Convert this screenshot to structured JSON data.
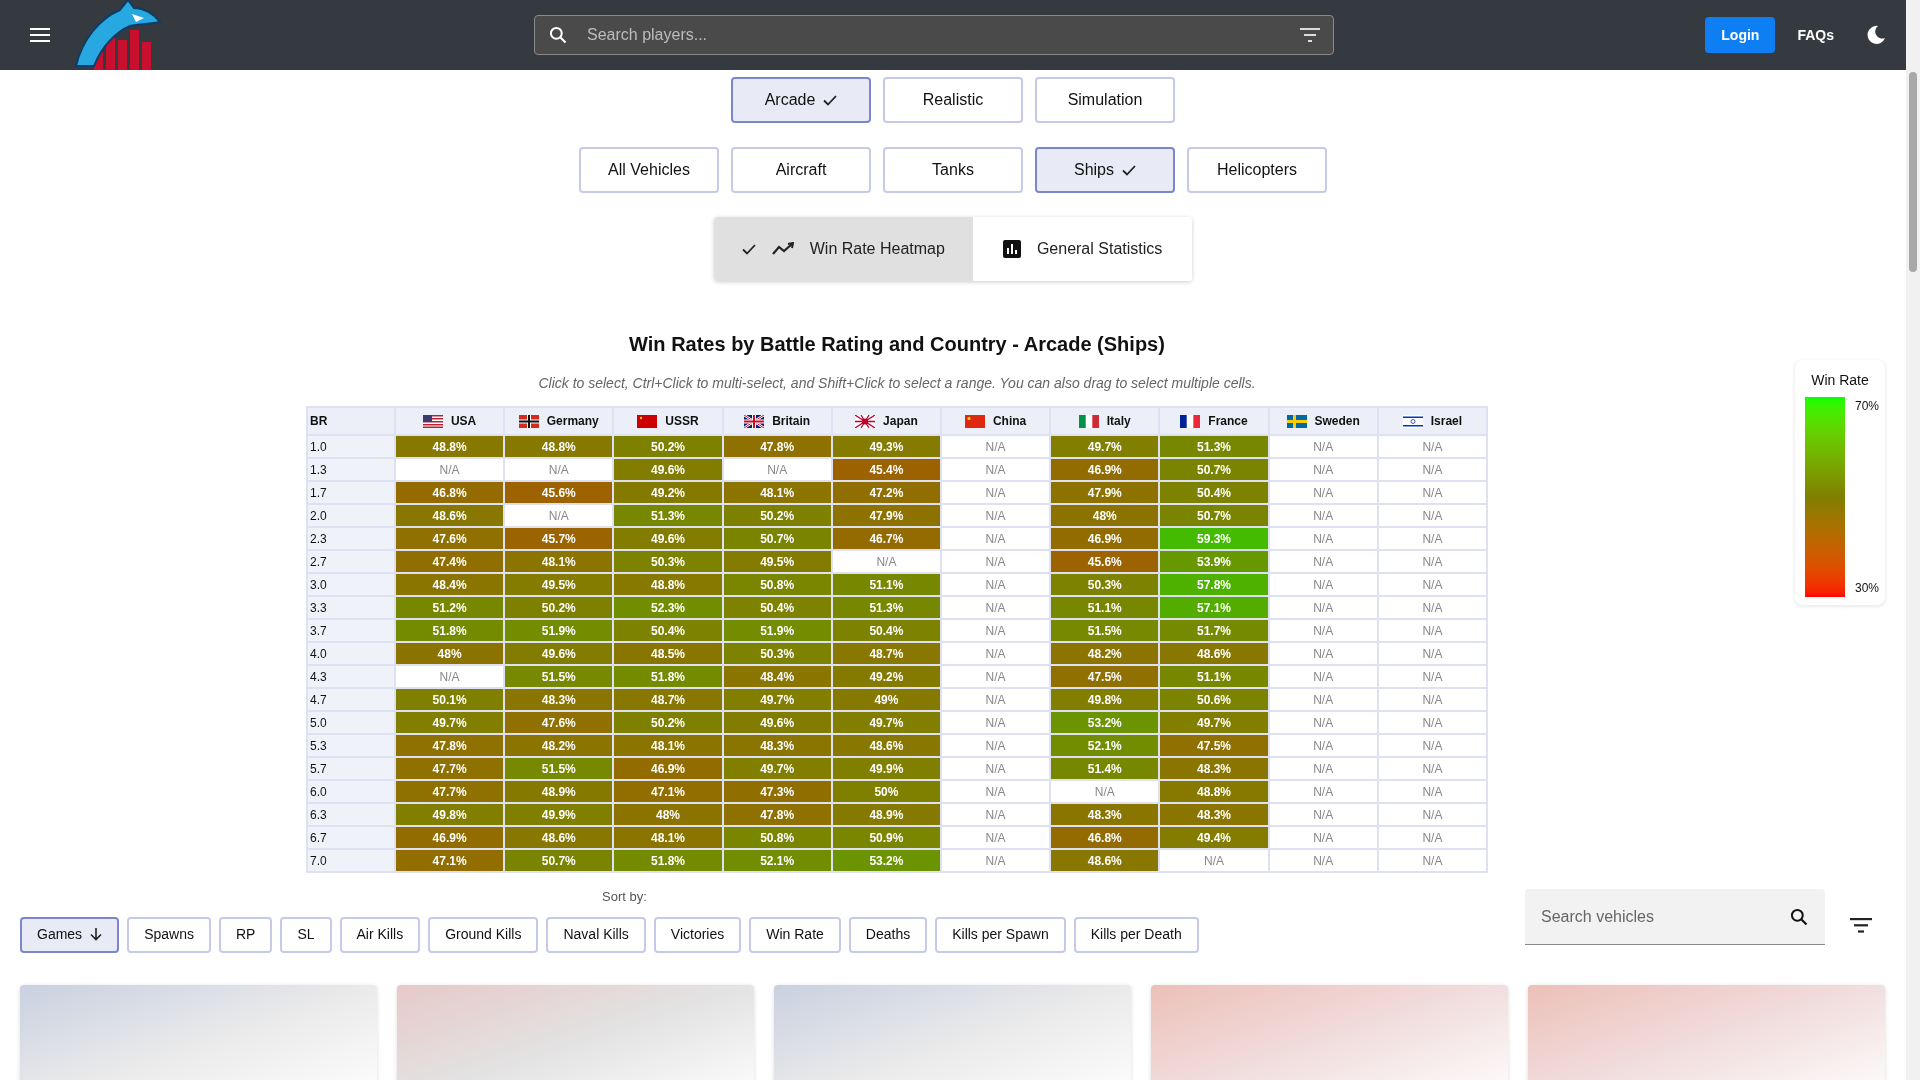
{
  "header": {
    "search": {
      "placeholder": "Search players..."
    },
    "login": "Login",
    "faqs": "FAQs"
  },
  "modes": [
    {
      "label": "Arcade",
      "selected": true
    },
    {
      "label": "Realistic",
      "selected": false
    },
    {
      "label": "Simulation",
      "selected": false
    }
  ],
  "vehicle_types": [
    {
      "label": "All Vehicles",
      "selected": false
    },
    {
      "label": "Aircraft",
      "selected": false
    },
    {
      "label": "Tanks",
      "selected": false
    },
    {
      "label": "Ships",
      "selected": true
    },
    {
      "label": "Helicopters",
      "selected": false
    }
  ],
  "views": [
    {
      "label": "Win Rate Heatmap",
      "selected": true,
      "kind": "heatmap"
    },
    {
      "label": "General Statistics",
      "selected": false,
      "kind": "stats"
    }
  ],
  "heatmap": {
    "title": "Win Rates by Battle Rating and Country - Arcade (Ships)",
    "hint": "Click to select, Ctrl+Click to multi-select, and Shift+Click to select a range. You can also drag to select multiple cells.",
    "corner": "BR",
    "countries": [
      {
        "name": "USA",
        "kind": "usa"
      },
      {
        "name": "Germany",
        "kind": "germany"
      },
      {
        "name": "USSR",
        "kind": "ussr"
      },
      {
        "name": "Britain",
        "kind": "britain"
      },
      {
        "name": "Japan",
        "kind": "japan"
      },
      {
        "name": "China",
        "kind": "china"
      },
      {
        "name": "Italy",
        "kind": "italy"
      },
      {
        "name": "France",
        "kind": "france"
      },
      {
        "name": "Sweden",
        "kind": "sweden"
      },
      {
        "name": "Israel",
        "kind": "israel"
      }
    ],
    "rows": [
      {
        "br": "1.0",
        "cells": [
          {
            "text": "48.8%",
            "color": "#877800"
          },
          {
            "text": "48.8%",
            "color": "#877800"
          },
          {
            "text": "50.2%",
            "color": "#7e8100"
          },
          {
            "text": "47.8%",
            "color": "#8e7100"
          },
          {
            "text": "49.3%",
            "color": "#847b00"
          },
          {
            "text": "N/A"
          },
          {
            "text": "49.7%",
            "color": "#817e00"
          },
          {
            "text": "51.3%",
            "color": "#778800"
          },
          {
            "text": "N/A"
          },
          {
            "text": "N/A"
          }
        ]
      },
      {
        "br": "1.3",
        "cells": [
          {
            "text": "N/A"
          },
          {
            "text": "N/A"
          },
          {
            "text": "49.6%",
            "color": "#827d00"
          },
          {
            "text": "N/A"
          },
          {
            "text": "45.4%",
            "color": "#9d6200"
          },
          {
            "text": "N/A"
          },
          {
            "text": "46.9%",
            "color": "#936c00"
          },
          {
            "text": "50.7%",
            "color": "#7b8400"
          },
          {
            "text": "N/A"
          },
          {
            "text": "N/A"
          }
        ]
      },
      {
        "br": "1.7",
        "cells": [
          {
            "text": "46.8%",
            "color": "#946b00"
          },
          {
            "text": "45.6%",
            "color": "#9c6300"
          },
          {
            "text": "49.2%",
            "color": "#857a00"
          },
          {
            "text": "48.1%",
            "color": "#8b7400"
          },
          {
            "text": "47.2%",
            "color": "#916e00"
          },
          {
            "text": "N/A"
          },
          {
            "text": "47.9%",
            "color": "#8d7200"
          },
          {
            "text": "50.4%",
            "color": "#7d8200"
          },
          {
            "text": "N/A"
          },
          {
            "text": "N/A"
          }
        ]
      },
      {
        "br": "2.0",
        "cells": [
          {
            "text": "48.6%",
            "color": "#887700"
          },
          {
            "text": "N/A"
          },
          {
            "text": "51.3%",
            "color": "#778800"
          },
          {
            "text": "50.2%",
            "color": "#7e8100"
          },
          {
            "text": "47.9%",
            "color": "#8d7200"
          },
          {
            "text": "N/A"
          },
          {
            "text": "48%",
            "color": "#8c7300"
          },
          {
            "text": "50.7%",
            "color": "#7b8400"
          },
          {
            "text": "N/A"
          },
          {
            "text": "N/A"
          }
        ]
      },
      {
        "br": "2.3",
        "cells": [
          {
            "text": "47.6%",
            "color": "#8f7000"
          },
          {
            "text": "45.7%",
            "color": "#9b6400"
          },
          {
            "text": "49.6%",
            "color": "#827d00"
          },
          {
            "text": "50.7%",
            "color": "#7b8400"
          },
          {
            "text": "46.7%",
            "color": "#946b00"
          },
          {
            "text": "N/A"
          },
          {
            "text": "46.9%",
            "color": "#936c00"
          },
          {
            "text": "59.3%",
            "color": "#44bb00"
          },
          {
            "text": "N/A"
          },
          {
            "text": "N/A"
          }
        ]
      },
      {
        "br": "2.7",
        "cells": [
          {
            "text": "47.4%",
            "color": "#906f00"
          },
          {
            "text": "48.1%",
            "color": "#8b7400"
          },
          {
            "text": "50.3%",
            "color": "#7d8200"
          },
          {
            "text": "49.5%",
            "color": "#837c00"
          },
          {
            "text": "N/A"
          },
          {
            "text": "N/A"
          },
          {
            "text": "45.6%",
            "color": "#9c6300"
          },
          {
            "text": "53.9%",
            "color": "#679800"
          },
          {
            "text": "N/A"
          },
          {
            "text": "N/A"
          }
        ]
      },
      {
        "br": "3.0",
        "cells": [
          {
            "text": "48.4%",
            "color": "#8a7500"
          },
          {
            "text": "49.5%",
            "color": "#837c00"
          },
          {
            "text": "48.8%",
            "color": "#877800"
          },
          {
            "text": "50.8%",
            "color": "#7a8500"
          },
          {
            "text": "51.1%",
            "color": "#788700"
          },
          {
            "text": "N/A"
          },
          {
            "text": "50.3%",
            "color": "#7d8200"
          },
          {
            "text": "57.8%",
            "color": "#4eb100"
          },
          {
            "text": "N/A"
          },
          {
            "text": "N/A"
          }
        ]
      },
      {
        "br": "3.3",
        "cells": [
          {
            "text": "51.2%",
            "color": "#788700"
          },
          {
            "text": "50.2%",
            "color": "#7e8100"
          },
          {
            "text": "52.3%",
            "color": "#718e00"
          },
          {
            "text": "50.4%",
            "color": "#7d8200"
          },
          {
            "text": "51.3%",
            "color": "#778800"
          },
          {
            "text": "N/A"
          },
          {
            "text": "51.1%",
            "color": "#788700"
          },
          {
            "text": "57.1%",
            "color": "#52ad00"
          },
          {
            "text": "N/A"
          },
          {
            "text": "N/A"
          }
        ]
      },
      {
        "br": "3.7",
        "cells": [
          {
            "text": "51.8%",
            "color": "#748b00"
          },
          {
            "text": "51.9%",
            "color": "#738c00"
          },
          {
            "text": "50.4%",
            "color": "#7d8200"
          },
          {
            "text": "51.9%",
            "color": "#738c00"
          },
          {
            "text": "50.4%",
            "color": "#7d8200"
          },
          {
            "text": "N/A"
          },
          {
            "text": "51.5%",
            "color": "#768900"
          },
          {
            "text": "51.7%",
            "color": "#758a00"
          },
          {
            "text": "N/A"
          },
          {
            "text": "N/A"
          }
        ]
      },
      {
        "br": "4.0",
        "cells": [
          {
            "text": "48%",
            "color": "#8c7300"
          },
          {
            "text": "49.6%",
            "color": "#827d00"
          },
          {
            "text": "48.5%",
            "color": "#897600"
          },
          {
            "text": "50.3%",
            "color": "#7d8200"
          },
          {
            "text": "48.7%",
            "color": "#887700"
          },
          {
            "text": "N/A"
          },
          {
            "text": "48.2%",
            "color": "#8b7400"
          },
          {
            "text": "48.6%",
            "color": "#887700"
          },
          {
            "text": "N/A"
          },
          {
            "text": "N/A"
          }
        ]
      },
      {
        "br": "4.3",
        "cells": [
          {
            "text": "N/A"
          },
          {
            "text": "51.5%",
            "color": "#768900"
          },
          {
            "text": "51.8%",
            "color": "#748b00"
          },
          {
            "text": "48.4%",
            "color": "#8a7500"
          },
          {
            "text": "49.2%",
            "color": "#857a00"
          },
          {
            "text": "N/A"
          },
          {
            "text": "47.5%",
            "color": "#8f7000"
          },
          {
            "text": "51.1%",
            "color": "#788700"
          },
          {
            "text": "N/A"
          },
          {
            "text": "N/A"
          }
        ]
      },
      {
        "br": "4.7",
        "cells": [
          {
            "text": "50.1%",
            "color": "#7f8000"
          },
          {
            "text": "48.3%",
            "color": "#8a7500"
          },
          {
            "text": "48.7%",
            "color": "#887700"
          },
          {
            "text": "49.7%",
            "color": "#817e00"
          },
          {
            "text": "49%",
            "color": "#867900"
          },
          {
            "text": "N/A"
          },
          {
            "text": "49.8%",
            "color": "#817e00"
          },
          {
            "text": "50.6%",
            "color": "#7c8300"
          },
          {
            "text": "N/A"
          },
          {
            "text": "N/A"
          }
        ]
      },
      {
        "br": "5.0",
        "cells": [
          {
            "text": "49.7%",
            "color": "#817e00"
          },
          {
            "text": "47.6%",
            "color": "#8f7000"
          },
          {
            "text": "50.2%",
            "color": "#7e8100"
          },
          {
            "text": "49.6%",
            "color": "#827d00"
          },
          {
            "text": "49.7%",
            "color": "#817e00"
          },
          {
            "text": "N/A"
          },
          {
            "text": "53.2%",
            "color": "#6b9400"
          },
          {
            "text": "49.7%",
            "color": "#817e00"
          },
          {
            "text": "N/A"
          },
          {
            "text": "N/A"
          }
        ]
      },
      {
        "br": "5.3",
        "cells": [
          {
            "text": "47.8%",
            "color": "#8e7100"
          },
          {
            "text": "48.2%",
            "color": "#8b7400"
          },
          {
            "text": "48.1%",
            "color": "#8b7400"
          },
          {
            "text": "48.3%",
            "color": "#8a7500"
          },
          {
            "text": "48.6%",
            "color": "#887700"
          },
          {
            "text": "N/A"
          },
          {
            "text": "52.1%",
            "color": "#728d00"
          },
          {
            "text": "47.5%",
            "color": "#8f7000"
          },
          {
            "text": "N/A"
          },
          {
            "text": "N/A"
          }
        ]
      },
      {
        "br": "5.7",
        "cells": [
          {
            "text": "47.7%",
            "color": "#8e7100"
          },
          {
            "text": "51.5%",
            "color": "#768900"
          },
          {
            "text": "46.9%",
            "color": "#936c00"
          },
          {
            "text": "49.7%",
            "color": "#817e00"
          },
          {
            "text": "49.9%",
            "color": "#807f00"
          },
          {
            "text": "N/A"
          },
          {
            "text": "51.4%",
            "color": "#778800"
          },
          {
            "text": "48.3%",
            "color": "#8a7500"
          },
          {
            "text": "N/A"
          },
          {
            "text": "N/A"
          }
        ]
      },
      {
        "br": "6.0",
        "cells": [
          {
            "text": "47.7%",
            "color": "#8e7100"
          },
          {
            "text": "48.9%",
            "color": "#867900"
          },
          {
            "text": "47.1%",
            "color": "#926d00"
          },
          {
            "text": "47.3%",
            "color": "#916e00"
          },
          {
            "text": "50%",
            "color": "#808000"
          },
          {
            "text": "N/A"
          },
          {
            "text": "N/A"
          },
          {
            "text": "48.8%",
            "color": "#877800"
          },
          {
            "text": "N/A"
          },
          {
            "text": "N/A"
          }
        ]
      },
      {
        "br": "6.3",
        "cells": [
          {
            "text": "49.8%",
            "color": "#817e00"
          },
          {
            "text": "49.9%",
            "color": "#807f00"
          },
          {
            "text": "48%",
            "color": "#8c7300"
          },
          {
            "text": "47.8%",
            "color": "#8e7100"
          },
          {
            "text": "48.9%",
            "color": "#867900"
          },
          {
            "text": "N/A"
          },
          {
            "text": "48.3%",
            "color": "#8a7500"
          },
          {
            "text": "48.3%",
            "color": "#8a7500"
          },
          {
            "text": "N/A"
          },
          {
            "text": "N/A"
          }
        ]
      },
      {
        "br": "6.7",
        "cells": [
          {
            "text": "46.9%",
            "color": "#936c00"
          },
          {
            "text": "48.6%",
            "color": "#887700"
          },
          {
            "text": "48.1%",
            "color": "#8b7400"
          },
          {
            "text": "50.8%",
            "color": "#7a8500"
          },
          {
            "text": "50.9%",
            "color": "#7a8500"
          },
          {
            "text": "N/A"
          },
          {
            "text": "46.8%",
            "color": "#946b00"
          },
          {
            "text": "49.4%",
            "color": "#837c00"
          },
          {
            "text": "N/A"
          },
          {
            "text": "N/A"
          }
        ]
      },
      {
        "br": "7.0",
        "cells": [
          {
            "text": "47.1%",
            "color": "#926d00"
          },
          {
            "text": "50.7%",
            "color": "#7b8400"
          },
          {
            "text": "51.8%",
            "color": "#748b00"
          },
          {
            "text": "52.1%",
            "color": "#728d00"
          },
          {
            "text": "53.2%",
            "color": "#6b9400"
          },
          {
            "text": "N/A"
          },
          {
            "text": "48.6%",
            "color": "#887700"
          },
          {
            "text": "N/A"
          },
          {
            "text": "N/A"
          },
          {
            "text": "N/A"
          }
        ]
      }
    ]
  },
  "legend": {
    "title": "Win Rate",
    "max": "70%",
    "min": "30%"
  },
  "sort": {
    "label": "Sort by:",
    "options": [
      {
        "label": "Games",
        "selected": true
      },
      {
        "label": "Spawns",
        "selected": false
      },
      {
        "label": "RP",
        "selected": false
      },
      {
        "label": "SL",
        "selected": false
      },
      {
        "label": "Air Kills",
        "selected": false
      },
      {
        "label": "Ground Kills",
        "selected": false
      },
      {
        "label": "Naval Kills",
        "selected": false
      },
      {
        "label": "Victories",
        "selected": false
      },
      {
        "label": "Win Rate",
        "selected": false
      },
      {
        "label": "Deaths",
        "selected": false
      },
      {
        "label": "Kills per Spawn",
        "selected": false
      },
      {
        "label": "Kills per Death",
        "selected": false
      }
    ]
  },
  "vehicle_search": {
    "placeholder": "Search vehicles"
  },
  "cards": [
    {
      "kind": "usa"
    },
    {
      "kind": "germany"
    },
    {
      "kind": "usa"
    },
    {
      "kind": "ussr"
    },
    {
      "kind": "ussr"
    }
  ]
}
